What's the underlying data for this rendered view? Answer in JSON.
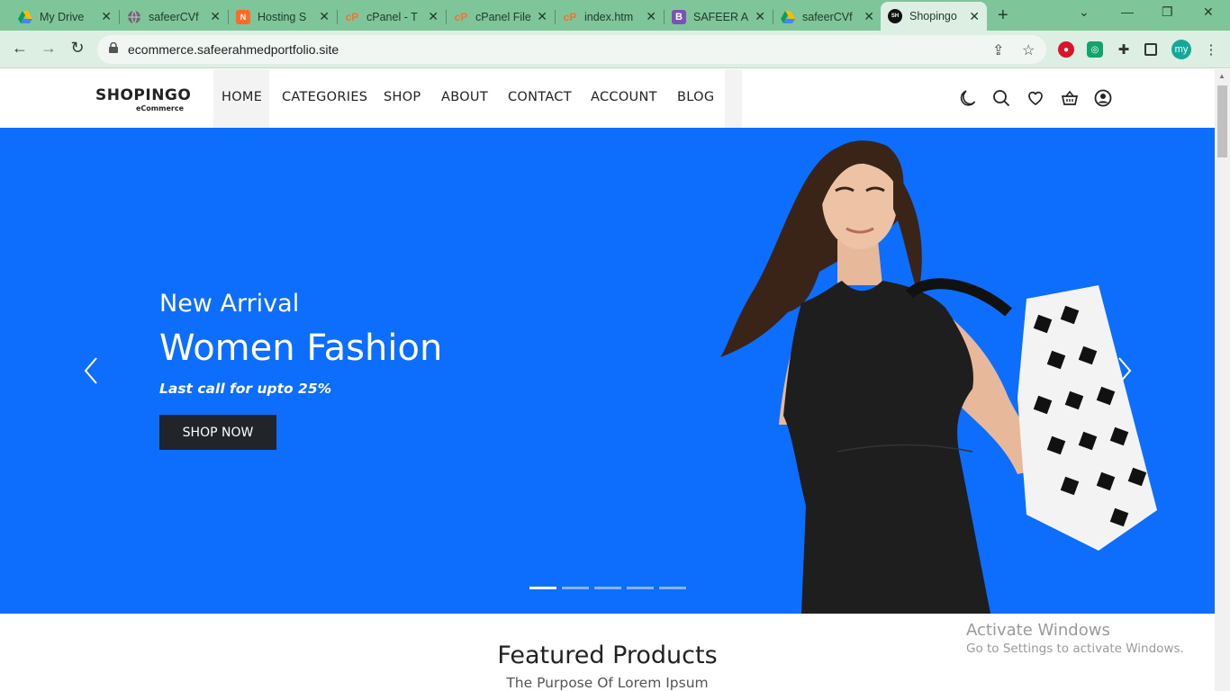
{
  "browser": {
    "tabs": [
      {
        "title": "My Drive",
        "icon": "google-drive-icon",
        "color": "#1fa463"
      },
      {
        "title": "safeerCVf",
        "icon": "globe-icon",
        "color": "#5f6368"
      },
      {
        "title": "Hosting S",
        "icon": "hostinger-icon",
        "color": "#ff6a2b"
      },
      {
        "title": "cPanel - T",
        "icon": "cpanel-icon",
        "color": "#ff6c2c"
      },
      {
        "title": "cPanel File",
        "icon": "cpanel-icon",
        "color": "#ff6c2c"
      },
      {
        "title": "index.htm",
        "icon": "cpanel-icon",
        "color": "#ff6c2c"
      },
      {
        "title": "SAFEER A",
        "icon": "bootstrap-icon",
        "color": "#7952b3"
      },
      {
        "title": "safeerCVf",
        "icon": "google-drive-icon",
        "color": "#1fa463"
      },
      {
        "title": "Shopingo",
        "icon": "shopingo-favicon",
        "color": "#111111"
      }
    ],
    "url": "ecommerce.safeerahmedportfolio.site",
    "profile_initials": "my"
  },
  "site": {
    "logo": {
      "name": "SHOPINGO",
      "tagline": "eCommerce"
    },
    "nav": [
      "HOME",
      "CATEGORIES",
      "SHOP",
      "ABOUT",
      "CONTACT",
      "ACCOUNT",
      "BLOG"
    ],
    "header_icons": [
      "moon-icon",
      "search-icon",
      "heart-icon",
      "basket-icon",
      "user-icon"
    ]
  },
  "hero": {
    "subtitle": "New Arrival",
    "title": "Women Fashion",
    "tagline": "Last call for upto 25%",
    "button": "SHOP NOW",
    "background_color": "#0d6efd",
    "slide_count": 5,
    "active_slide": 1
  },
  "featured": {
    "title": "Featured Products",
    "subtitle": "The Purpose Of Lorem Ipsum"
  },
  "os_watermark": {
    "line1": "Activate Windows",
    "line2": "Go to Settings to activate Windows."
  }
}
